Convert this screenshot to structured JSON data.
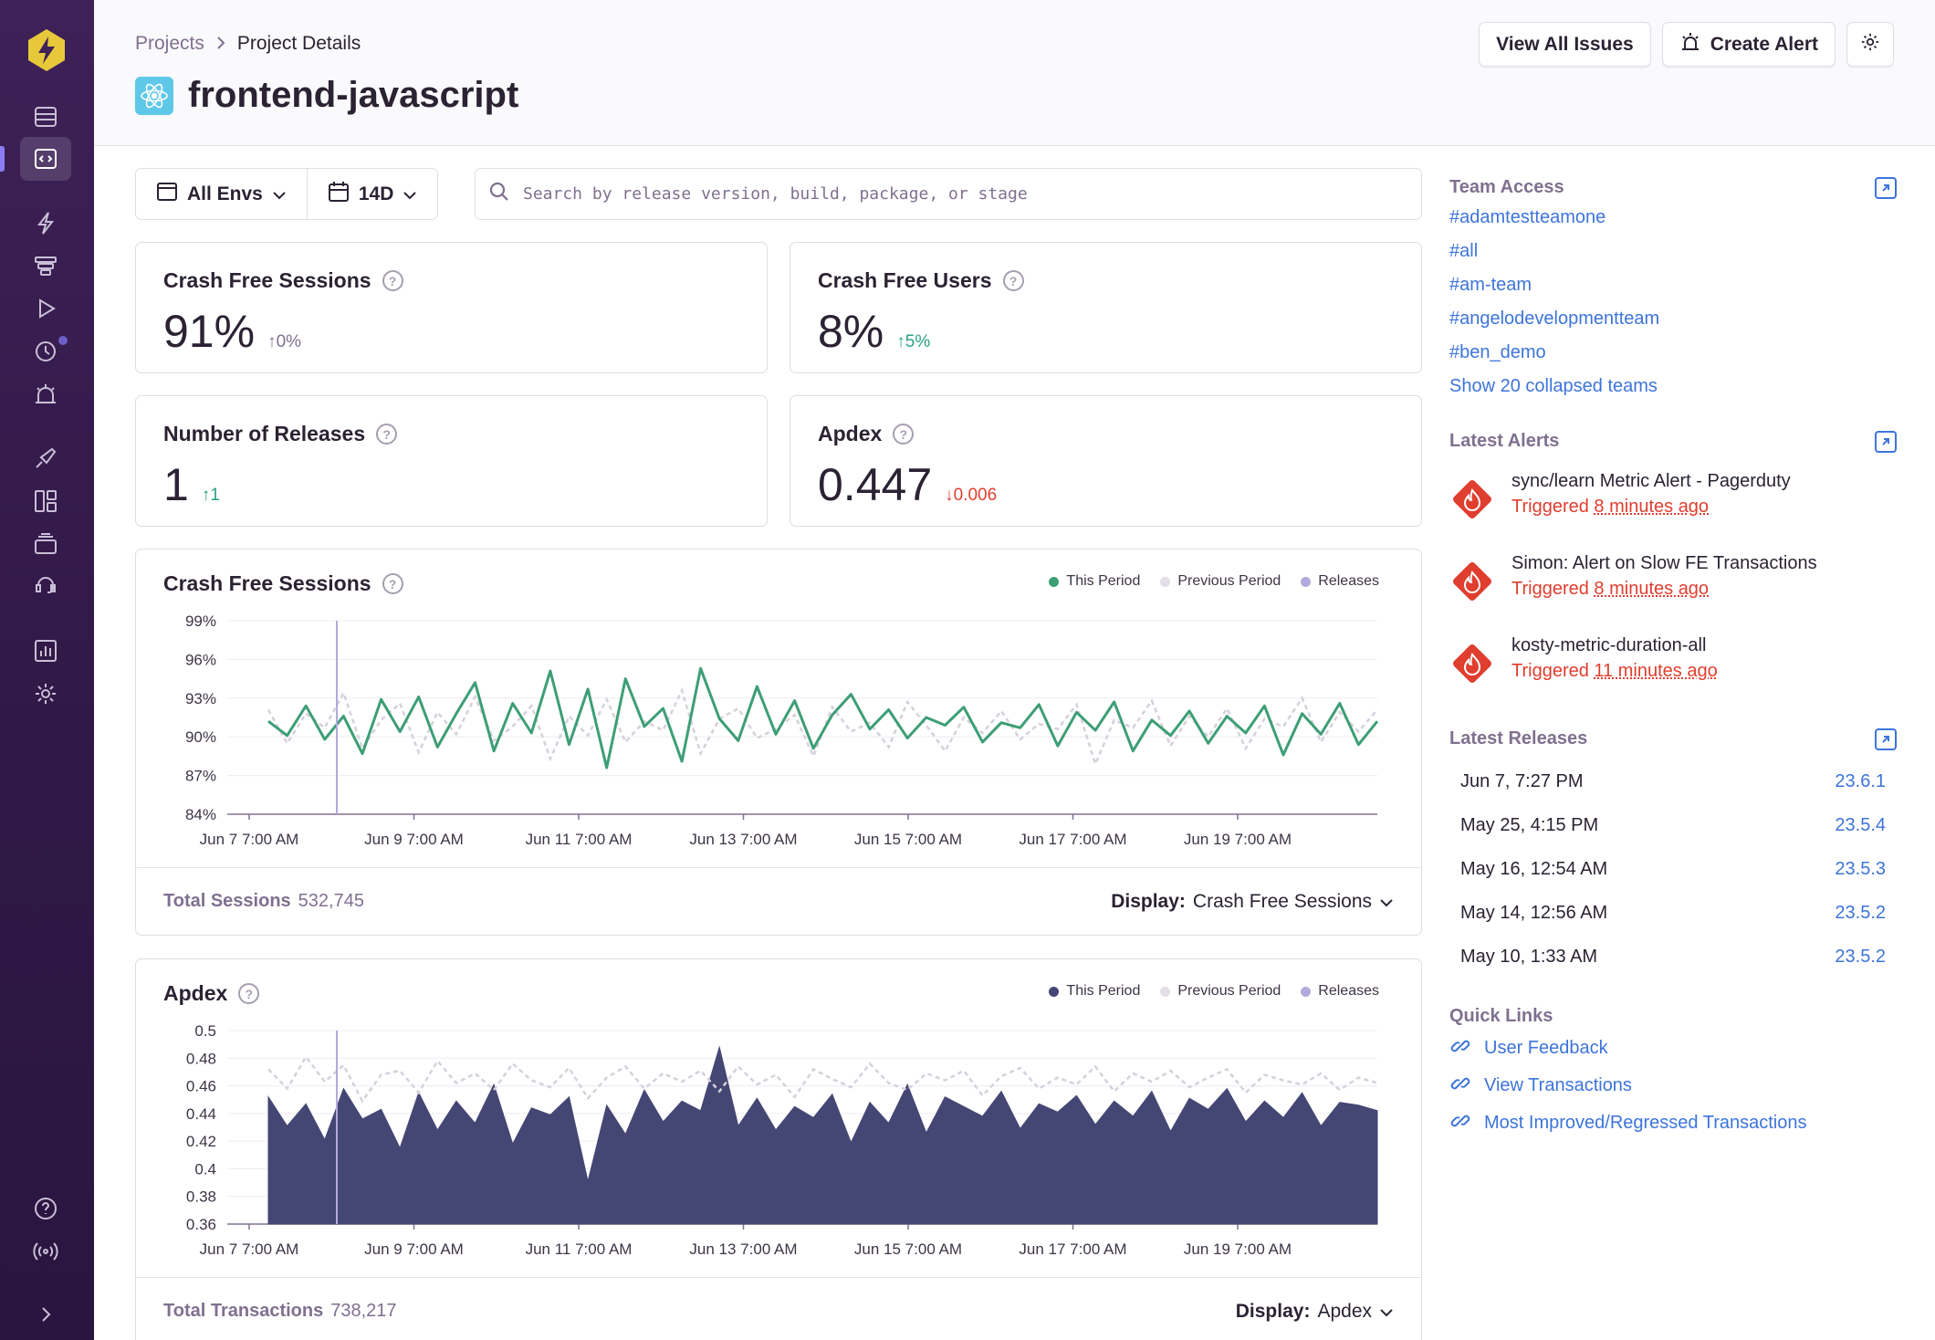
{
  "breadcrumb": {
    "parent": "Projects",
    "current": "Project Details"
  },
  "project": {
    "name": "frontend-javascript"
  },
  "header_buttons": {
    "view_all_issues": "View All Issues",
    "create_alert": "Create Alert"
  },
  "filters": {
    "environment": "All Envs",
    "period": "14D"
  },
  "search": {
    "placeholder": "Search by release version, build, package, or stage"
  },
  "scores": [
    {
      "label": "Crash Free Sessions",
      "value": "91%",
      "delta": "0%",
      "trend": "neutral"
    },
    {
      "label": "Crash Free Users",
      "value": "8%",
      "delta": "5%",
      "trend": "up"
    },
    {
      "label": "Number of Releases",
      "value": "1",
      "delta": "1",
      "trend": "up"
    },
    {
      "label": "Apdex",
      "value": "0.447",
      "delta": "0.006",
      "trend": "down"
    }
  ],
  "legend": {
    "this_period": "This Period",
    "previous_period": "Previous Period",
    "releases": "Releases"
  },
  "colors": {
    "sessions_line": "#3d9e76",
    "apdex_area": "#444674",
    "previous": "#d6d0dc",
    "releases": "#b3a9dc",
    "accent": "#6c5fc7",
    "link": "#3d74db",
    "danger": "#e03e2f"
  },
  "chart_data": [
    {
      "type": "line",
      "title": "Crash Free Sessions",
      "y_ticks": [
        "99%",
        "96%",
        "93%",
        "90%",
        "87%",
        "84%"
      ],
      "ylim": [
        84,
        99
      ],
      "x_ticks": [
        "Jun 7 7:00 AM",
        "Jun 9 7:00 AM",
        "Jun 11 7:00 AM",
        "Jun 13 7:00 AM",
        "Jun 15 7:00 AM",
        "Jun 17 7:00 AM",
        "Jun 19 7:00 AM"
      ],
      "series": [
        {
          "name": "This Period",
          "values": [
            91.2,
            90.1,
            92.4,
            89.8,
            91.6,
            88.7,
            92.9,
            90.4,
            93.1,
            89.2,
            91.8,
            94.2,
            88.9,
            92.6,
            90.3,
            95.1,
            89.4,
            93.7,
            87.6,
            94.5,
            90.8,
            92.2,
            88.1,
            95.3,
            91.4,
            89.7,
            93.9,
            90.2,
            92.8,
            89.1,
            91.7,
            93.3,
            90.6,
            92.1,
            89.9,
            91.5,
            90.9,
            92.3,
            89.6,
            91.1,
            90.7,
            92.5,
            89.3,
            91.9,
            90.5,
            92.7,
            88.9,
            91.3,
            90.1,
            92.0,
            89.5,
            91.6,
            90.3,
            92.4,
            88.6,
            91.8,
            90.2,
            92.6,
            89.4,
            91.2
          ],
          "color": "#3d9e76"
        },
        {
          "name": "Previous Period",
          "values": [
            92.1,
            89.5,
            91.8,
            90.7,
            93.4,
            89.1,
            91.3,
            92.6,
            88.8,
            91.9,
            90.2,
            93.1,
            89.7,
            90.8,
            92.4,
            88.3,
            91.6,
            90.1,
            92.9,
            89.6,
            91.2,
            90.5,
            93.6,
            88.7,
            91.4,
            92.2,
            89.9,
            90.6,
            91.7,
            88.5,
            92.3,
            90.4,
            91.1,
            89.2,
            92.7,
            90.9,
            88.9,
            91.5,
            90.3,
            92.0,
            89.8,
            91.0,
            90.6,
            92.5,
            87.9,
            91.3,
            90.7,
            92.8,
            89.3,
            91.6,
            90.0,
            92.2,
            89.1,
            91.4,
            90.8,
            93.0,
            89.6,
            91.9,
            90.4,
            92.1
          ],
          "color": "#d6d0dc"
        }
      ],
      "releases": [
        "Jun 7, 7:27 PM"
      ],
      "footer": {
        "total_label": "Total Sessions",
        "total_value": "532,745",
        "display_label": "Display:",
        "display_value": "Crash Free Sessions"
      }
    },
    {
      "type": "area",
      "title": "Apdex",
      "y_ticks": [
        "0.5",
        "0.48",
        "0.46",
        "0.44",
        "0.42",
        "0.4",
        "0.38",
        "0.36"
      ],
      "ylim": [
        0.36,
        0.5
      ],
      "x_ticks": [
        "Jun 7 7:00 AM",
        "Jun 9 7:00 AM",
        "Jun 11 7:00 AM",
        "Jun 13 7:00 AM",
        "Jun 15 7:00 AM",
        "Jun 17 7:00 AM",
        "Jun 19 7:00 AM"
      ],
      "series": [
        {
          "name": "This Period",
          "values": [
            0.452,
            0.431,
            0.447,
            0.421,
            0.458,
            0.436,
            0.443,
            0.415,
            0.455,
            0.428,
            0.449,
            0.433,
            0.461,
            0.418,
            0.444,
            0.439,
            0.452,
            0.391,
            0.446,
            0.425,
            0.457,
            0.434,
            0.449,
            0.442,
            0.488,
            0.431,
            0.451,
            0.428,
            0.445,
            0.437,
            0.454,
            0.419,
            0.448,
            0.433,
            0.461,
            0.426,
            0.452,
            0.445,
            0.438,
            0.456,
            0.429,
            0.447,
            0.441,
            0.453,
            0.432,
            0.449,
            0.438,
            0.456,
            0.427,
            0.451,
            0.443,
            0.458,
            0.434,
            0.449,
            0.437,
            0.455,
            0.431,
            0.448,
            0.446,
            0.442
          ],
          "color": "#444674"
        },
        {
          "name": "Previous Period",
          "values": [
            0.472,
            0.458,
            0.481,
            0.463,
            0.475,
            0.449,
            0.468,
            0.471,
            0.455,
            0.478,
            0.462,
            0.469,
            0.457,
            0.476,
            0.464,
            0.459,
            0.473,
            0.451,
            0.466,
            0.474,
            0.458,
            0.469,
            0.463,
            0.471,
            0.456,
            0.474,
            0.461,
            0.468,
            0.452,
            0.472,
            0.465,
            0.459,
            0.476,
            0.462,
            0.457,
            0.469,
            0.464,
            0.471,
            0.453,
            0.467,
            0.473,
            0.458,
            0.466,
            0.461,
            0.474,
            0.456,
            0.469,
            0.463,
            0.471,
            0.459,
            0.466,
            0.472,
            0.455,
            0.468,
            0.464,
            0.461,
            0.469,
            0.457,
            0.466,
            0.462
          ],
          "color": "#d6d0dc"
        }
      ],
      "releases": [
        "Jun 7, 7:27 PM"
      ],
      "footer": {
        "total_label": "Total Transactions",
        "total_value": "738,217",
        "display_label": "Display:",
        "display_value": "Apdex"
      }
    }
  ],
  "team_access": {
    "title": "Team Access",
    "teams": [
      "#adamtestteamone",
      "#all",
      "#am-team",
      "#angelodevelopmentteam",
      "#ben_demo"
    ],
    "show_more": "Show 20 collapsed teams"
  },
  "latest_alerts": {
    "title": "Latest Alerts",
    "items": [
      {
        "name": "sync/learn Metric Alert - Pagerduty",
        "status": "Triggered",
        "when": "8 minutes ago"
      },
      {
        "name": "Simon: Alert on Slow FE Transactions",
        "status": "Triggered",
        "when": "8 minutes ago"
      },
      {
        "name": "kosty-metric-duration-all",
        "status": "Triggered",
        "when": "11 minutes ago"
      }
    ]
  },
  "latest_releases": {
    "title": "Latest Releases",
    "items": [
      {
        "date": "Jun 7, 7:27 PM",
        "version": "23.6.1"
      },
      {
        "date": "May 25, 4:15 PM",
        "version": "23.5.4"
      },
      {
        "date": "May 16, 12:54 AM",
        "version": "23.5.3"
      },
      {
        "date": "May 14, 12:56 AM",
        "version": "23.5.2"
      },
      {
        "date": "May 10, 1:33 AM",
        "version": "23.5.2"
      }
    ]
  },
  "quick_links": {
    "title": "Quick Links",
    "links": [
      "User Feedback",
      "View Transactions",
      "Most Improved/Regressed Transactions"
    ]
  },
  "sidebar_icons": [
    "logo-icon",
    "issues-icon",
    "projects-icon",
    "performance-icon",
    "profiling-icon",
    "replays-icon",
    "crons-icon",
    "alerts-icon",
    "releases-icon",
    "dashboards-icon",
    "discover-icon",
    "user-feedback-icon",
    "stats-icon",
    "settings-icon",
    "help-icon",
    "broadcasts-icon",
    "collapse-icon"
  ]
}
